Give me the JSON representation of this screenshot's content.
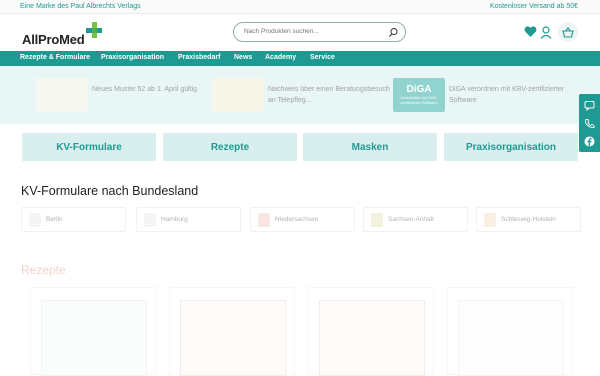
{
  "topbar": {
    "left_text": "Eine Marke des Paul Albrechts Verlags",
    "right_text": "Kostenloser Versand ab 50€"
  },
  "header": {
    "logo_text": "AllProMed",
    "search_placeholder": "Nach Produkten suchen...",
    "icons": [
      "heart-icon",
      "user-icon",
      "cart-icon"
    ]
  },
  "nav": {
    "items": [
      "Rezepte & Formulare",
      "Praxisorganisation",
      "Praxisbedarf",
      "News",
      "Academy",
      "Service"
    ]
  },
  "banner": {
    "items": [
      {
        "text": "Neues Muster 52 ab 1. April gültig"
      },
      {
        "text": "Nachweis über einen Beratungsbesuch an Telepfleg..."
      },
      {
        "text": "DiGA verordnen mit KBV-zertifizierter Software",
        "badge": "DiGA",
        "badge_sub": "Unterstützt von KBV-zertifizierter Software"
      }
    ]
  },
  "categories": [
    "KV-Formulare",
    "Rezepte",
    "Masken",
    "Praxisorganisation"
  ],
  "section_bundesland": {
    "title": "KV-Formulare nach Bundesland",
    "states": [
      "Berlin",
      "Hamburg",
      "Niedersachsen",
      "Sachsen-Anhalt",
      "Schleswig-Holstein"
    ]
  },
  "section_rezepte": {
    "title": "Rezepte"
  },
  "colors": {
    "brand": "#1f9a92",
    "light_teal": "#d8efee",
    "accent_green": "#7ac143"
  },
  "side_icons": [
    "chat-icon",
    "phone-icon",
    "facebook-icon"
  ]
}
